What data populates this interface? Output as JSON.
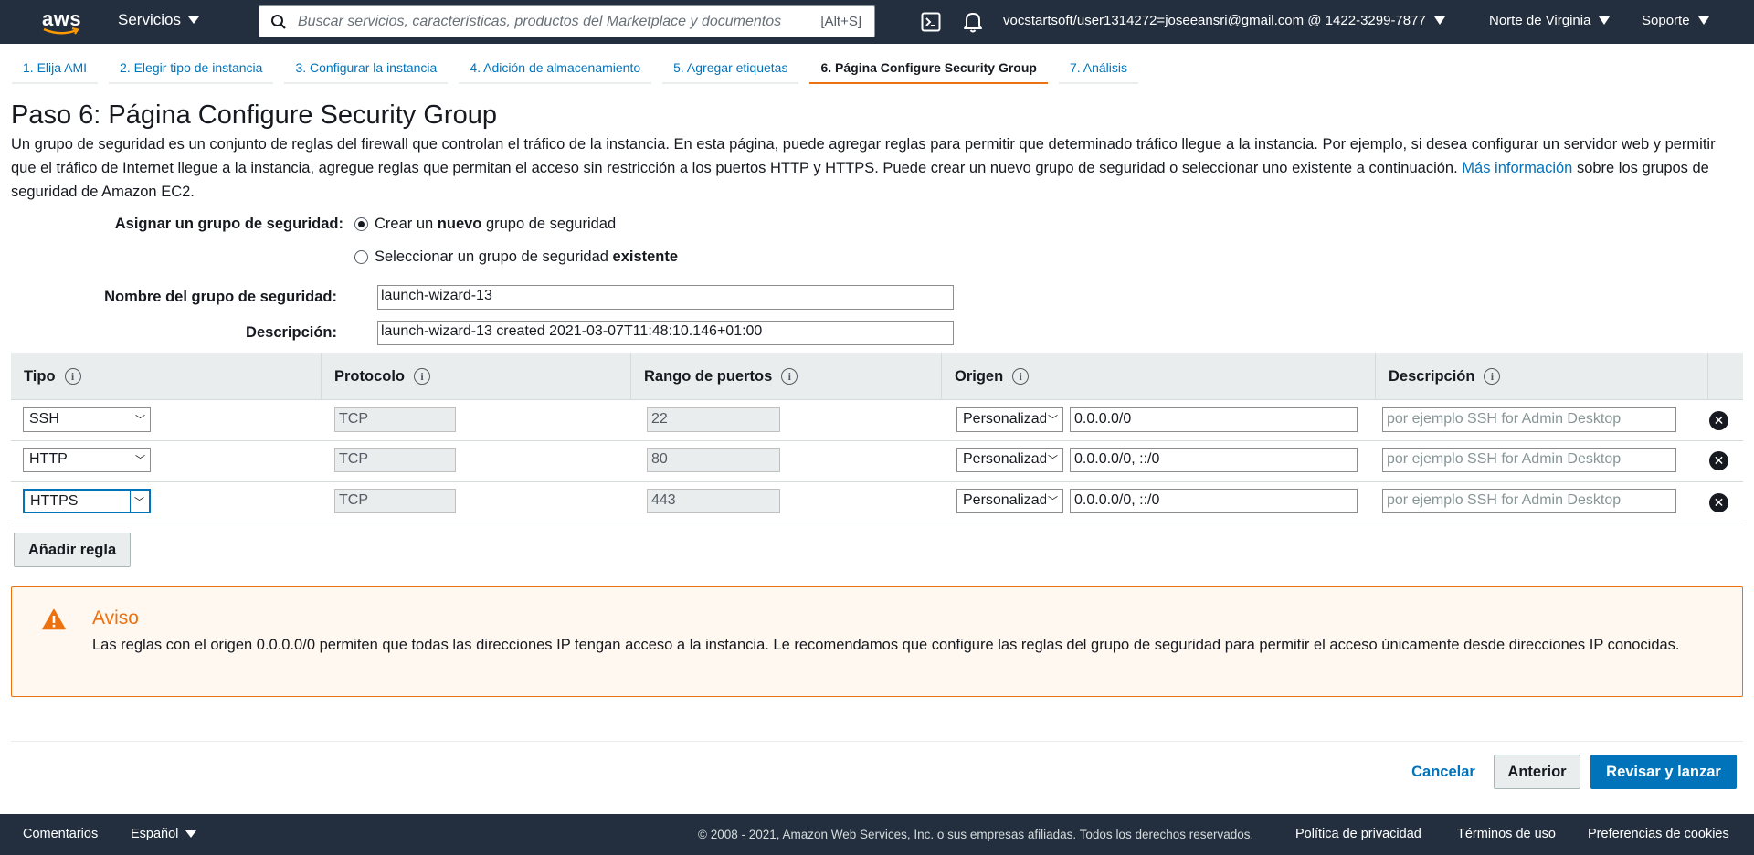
{
  "topnav": {
    "logo": "aws",
    "services": "Servicios",
    "search_placeholder": "Buscar servicios, características, productos del Marketplace y documentos",
    "search_shortcut": "[Alt+S]",
    "user": "vocstartsoft/user1314272=joseeansri@gmail.com @ 1422-3299-7877",
    "region": "Norte de Virginia",
    "support": "Soporte",
    "icons": [
      "cloudshell-icon",
      "bell-icon"
    ]
  },
  "steps": [
    {
      "label": "1. Elija AMI",
      "active": false
    },
    {
      "label": "2. Elegir tipo de instancia",
      "active": false
    },
    {
      "label": "3. Configurar la instancia",
      "active": false
    },
    {
      "label": "4. Adición de almacenamiento",
      "active": false
    },
    {
      "label": "5. Agregar etiquetas",
      "active": false
    },
    {
      "label": "6. Página Configure Security Group",
      "active": true
    },
    {
      "label": "7. Análisis",
      "active": false
    }
  ],
  "page": {
    "title": "Paso 6: Página Configure Security Group",
    "intro": "Un grupo de seguridad es un conjunto de reglas del firewall que controlan el tráfico de la instancia. En esta página, puede agregar reglas para permitir que determinado tráfico llegue a la instancia. Por ejemplo, si desea configurar un servidor web y permitir que el tráfico de Internet llegue a la instancia, agregue reglas que permitan el acceso sin restricción a los puertos HTTP y HTTPS. Puede crear un nuevo grupo de seguridad o seleccionar uno existente a continuación.",
    "intro_link": "Más información",
    "intro_tail": "sobre los grupos de seguridad de Amazon EC2."
  },
  "form": {
    "assign_label": "Asignar un grupo de seguridad:",
    "radio_new_pre": "Crear un ",
    "radio_new_bold": "nuevo",
    "radio_new_post": " grupo de seguridad",
    "radio_existing_pre": "Seleccionar un grupo de seguridad ",
    "radio_existing_bold": "existente",
    "selected": "new",
    "name_label": "Nombre del grupo de seguridad:",
    "name_value": "launch-wizard-13",
    "desc_label": "Descripción:",
    "desc_value": "launch-wizard-13 created 2021-03-07T11:48:10.146+01:00"
  },
  "table": {
    "headers": [
      "Tipo",
      "Protocolo",
      "Rango de puertos",
      "Origen",
      "Descripción"
    ],
    "rows": [
      {
        "type": "SSH",
        "protocol": "TCP",
        "ports": "22",
        "source_kind": "Personalizado",
        "source": "0.0.0.0/0",
        "description_placeholder": "por ejemplo SSH for Admin Desktop"
      },
      {
        "type": "HTTP",
        "protocol": "TCP",
        "ports": "80",
        "source_kind": "Personalizado",
        "source": "0.0.0.0/0, ::/0",
        "description_placeholder": "por ejemplo SSH for Admin Desktop"
      },
      {
        "type": "HTTPS",
        "protocol": "TCP",
        "ports": "443",
        "source_kind": "Personalizado",
        "source": "0.0.0.0/0, ::/0",
        "description_placeholder": "por ejemplo SSH for Admin Desktop"
      }
    ],
    "add_rule": "Añadir regla"
  },
  "warning": {
    "title": "Aviso",
    "text": "Las reglas con el origen 0.0.0.0/0 permiten que todas las direcciones IP tengan acceso a la instancia. Le recomendamos que configure las reglas del grupo de seguridad para permitir el acceso únicamente desde direcciones IP conocidas."
  },
  "actions": {
    "cancel": "Cancelar",
    "previous": "Anterior",
    "review": "Revisar y lanzar"
  },
  "footer": {
    "feedback": "Comentarios",
    "language": "Español",
    "copyright": "© 2008 - 2021, Amazon Web Services, Inc. o sus empresas afiliadas. Todos los derechos reservados.",
    "privacy": "Política de privacidad",
    "terms": "Términos de uso",
    "cookies": "Preferencias de cookies"
  },
  "colors": {
    "nav_bg": "#232f3e",
    "link": "#0073bb",
    "accent": "#ec7211",
    "primary": "#0073bb"
  }
}
